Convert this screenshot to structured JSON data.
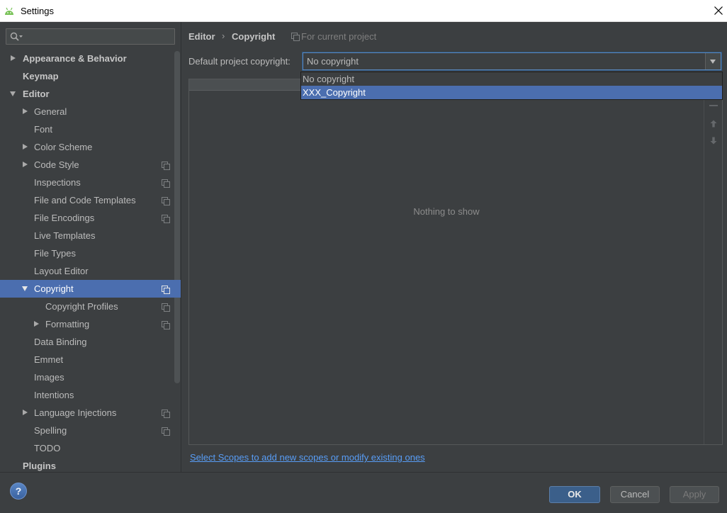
{
  "window": {
    "title": "Settings",
    "app_icon": "android-icon",
    "close_icon": "close-icon"
  },
  "sidebar": {
    "search": {
      "value": "",
      "icon": "search-icon"
    },
    "tree": [
      {
        "label": "Appearance & Behavior",
        "expanded": false
      },
      {
        "label": "Keymap"
      },
      {
        "label": "Editor",
        "expanded": true,
        "children": [
          {
            "label": "General",
            "expanded": false
          },
          {
            "label": "Font"
          },
          {
            "label": "Color Scheme",
            "expanded": false
          },
          {
            "label": "Code Style",
            "expanded": false,
            "icon": "project-scope-icon"
          },
          {
            "label": "Inspections",
            "icon": "project-scope-icon"
          },
          {
            "label": "File and Code Templates",
            "icon": "project-scope-icon"
          },
          {
            "label": "File Encodings",
            "icon": "project-scope-icon"
          },
          {
            "label": "Live Templates"
          },
          {
            "label": "File Types"
          },
          {
            "label": "Layout Editor"
          },
          {
            "label": "Copyright",
            "expanded": true,
            "selected": true,
            "icon": "project-scope-icon",
            "children": [
              {
                "label": "Copyright Profiles",
                "icon": "project-scope-icon"
              },
              {
                "label": "Formatting",
                "expanded": false,
                "icon": "project-scope-icon"
              }
            ]
          },
          {
            "label": "Data Binding"
          },
          {
            "label": "Emmet"
          },
          {
            "label": "Images"
          },
          {
            "label": "Intentions"
          },
          {
            "label": "Language Injections",
            "expanded": false,
            "icon": "project-scope-icon"
          },
          {
            "label": "Spelling",
            "icon": "project-scope-icon"
          },
          {
            "label": "TODO"
          }
        ]
      },
      {
        "label": "Plugins"
      }
    ]
  },
  "main": {
    "breadcrumb": {
      "parent": "Editor",
      "separator": "›",
      "current": "Copyright",
      "scope_note": "For current project",
      "scope_icon": "project-scope-icon"
    },
    "default_copyright": {
      "label": "Default project copyright:",
      "value": "No copyright",
      "dropdown_open": true,
      "options": [
        {
          "label": "No copyright",
          "highlighted": false
        },
        {
          "label": "XXX_Copyright",
          "highlighted": true
        }
      ]
    },
    "scopes_table": {
      "empty_text": "Nothing to show",
      "toolbar_icons": [
        "remove-icon",
        "move-up-icon",
        "move-down-icon"
      ]
    },
    "scopes_link": "Select Scopes to add new scopes or modify existing ones"
  },
  "footer": {
    "help": "?",
    "buttons": {
      "ok": "OK",
      "cancel": "Cancel",
      "apply": "Apply"
    },
    "apply_enabled": false
  },
  "colors": {
    "background": "#3c3f41",
    "text": "#bbbbbb",
    "selection": "#4b6eaf",
    "link": "#589df6",
    "default_button": "#3b5f8a"
  }
}
